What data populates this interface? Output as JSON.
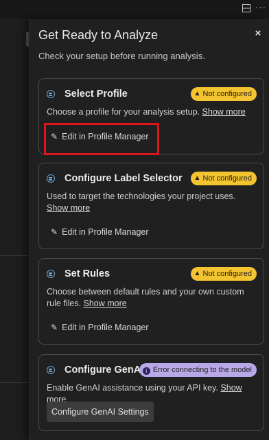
{
  "top_icons": {
    "layout_icon": "split-layout-icon",
    "more_icon": "more-icon"
  },
  "panel": {
    "title": "Get Ready to Analyze",
    "subtitle": "Check your setup before running analysis.",
    "close_label": "×"
  },
  "cards": [
    {
      "title": "Select Profile",
      "badge": "Not configured",
      "desc": "Choose a profile for your analysis setup.",
      "link": "Show more",
      "action": "Edit in Profile Manager"
    },
    {
      "title": "Configure Label Selector",
      "badge": "Not configured",
      "desc": "Used to target the technologies your project uses.",
      "link": "Show more",
      "action": "Edit in Profile Manager"
    },
    {
      "title": "Set Rules",
      "badge": "Not configured",
      "desc": "Choose between default rules and your own custom rule files.",
      "link": "Show more",
      "action": "Edit in Profile Manager"
    },
    {
      "title": "Configure GenAI",
      "badge": "Error connecting to the model",
      "desc": "Enable GenAI assistance using your API key.",
      "link": "Show more",
      "action": "Configure GenAI Settings"
    }
  ],
  "colors": {
    "badge_warning": "#f4c430",
    "badge_error": "#b9a8e8",
    "highlight": "#e0141b",
    "icon_accent": "#6fa8d6"
  }
}
